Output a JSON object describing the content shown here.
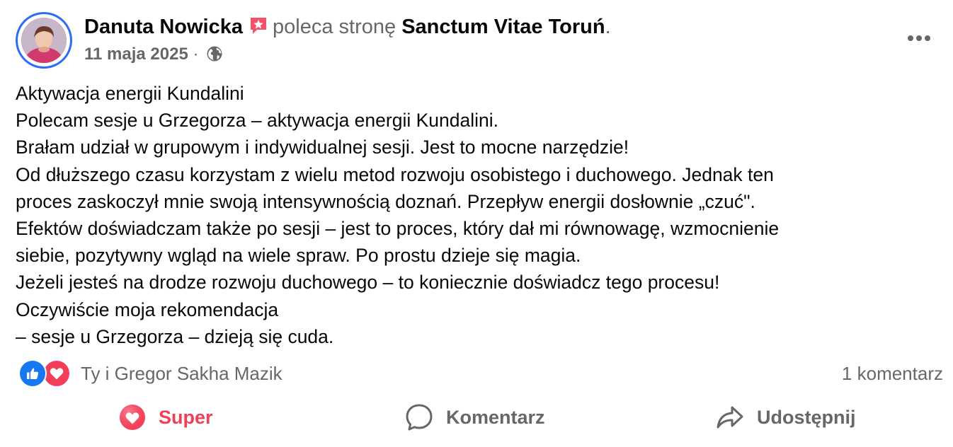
{
  "header": {
    "author_name": "Danuta Nowicka",
    "recommends_text": "poleca stronę",
    "page_name": "Sanctum Vitae Toruń",
    "period": ".",
    "date": "11 maja 2025",
    "separator": "·",
    "audience_icon": "globe-icon",
    "more_icon": "more-dots-icon"
  },
  "post": {
    "lines": [
      "Aktywacja energii Kundalini",
      "Polecam sesje u Grzegorza – aktywacja energii Kundalini.",
      "Brałam udział w grupowym i indywidualnej sesji. Jest to mocne narzędzie!",
      "Od dłuższego czasu korzystam z wielu metod rozwoju osobistego i duchowego. Jednak ten",
      "proces zaskoczył  mnie swoją intensywnością doznań. Przepływ energii dosłownie „czuć\".",
      "Efektów doświadczam także po sesji – jest to proces, który dał mi równowagę, wzmocnienie",
      "siebie, pozytywny wgląd na wiele spraw. Po prostu dzieje się magia.",
      "Jeżeli jesteś na drodze rozwoju duchowego – to koniecznie doświadcz tego procesu!",
      "Oczywiście moja rekomendacja",
      "– sesje u Grzegorza – dzieją się cuda."
    ]
  },
  "reactions": {
    "icons": [
      "like-icon",
      "love-icon"
    ],
    "names": "Ty i Gregor Sakha Mazik",
    "comments": "1 komentarz"
  },
  "actions": {
    "super_label": "Super",
    "comment_label": "Komentarz",
    "share_label": "Udostępnij"
  },
  "colors": {
    "love": "#f33e58",
    "like": "#1877f2",
    "muted": "#65676b",
    "text": "#080809",
    "avatar_ring": "#2d6df6"
  }
}
